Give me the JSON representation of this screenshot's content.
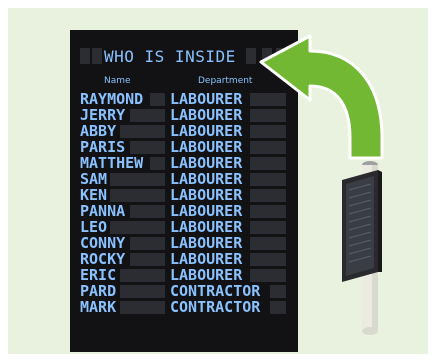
{
  "board": {
    "title": "WHO IS INSIDE",
    "col_name": "Name",
    "col_department": "Department",
    "rows": [
      {
        "name": "RAYMOND",
        "dept": "LABOURER"
      },
      {
        "name": "JERRY",
        "dept": "LABOURER"
      },
      {
        "name": "ABBY",
        "dept": "LABOURER"
      },
      {
        "name": "PARIS",
        "dept": "LABOURER"
      },
      {
        "name": "MATTHEW",
        "dept": "LABOURER"
      },
      {
        "name": "SAM",
        "dept": "LABOURER"
      },
      {
        "name": "KEN",
        "dept": "LABOURER"
      },
      {
        "name": "PANNA",
        "dept": "LABOURER"
      },
      {
        "name": "LEO",
        "dept": "LABOURER"
      },
      {
        "name": "CONNY",
        "dept": "LABOURER"
      },
      {
        "name": "ROCKY",
        "dept": "LABOURER"
      },
      {
        "name": "ERIC",
        "dept": "LABOURER"
      },
      {
        "name": "PARD",
        "dept": "CONTRACTOR"
      },
      {
        "name": "MARK",
        "dept": "CONTRACTOR"
      }
    ]
  },
  "colors": {
    "background": "#e9f2de",
    "board": "#121214",
    "text": "#89c2ff",
    "arrow": "#72b832",
    "cell": "#2c2d33"
  },
  "icons": [
    "curved-arrow-icon",
    "kiosk-display-icon"
  ]
}
